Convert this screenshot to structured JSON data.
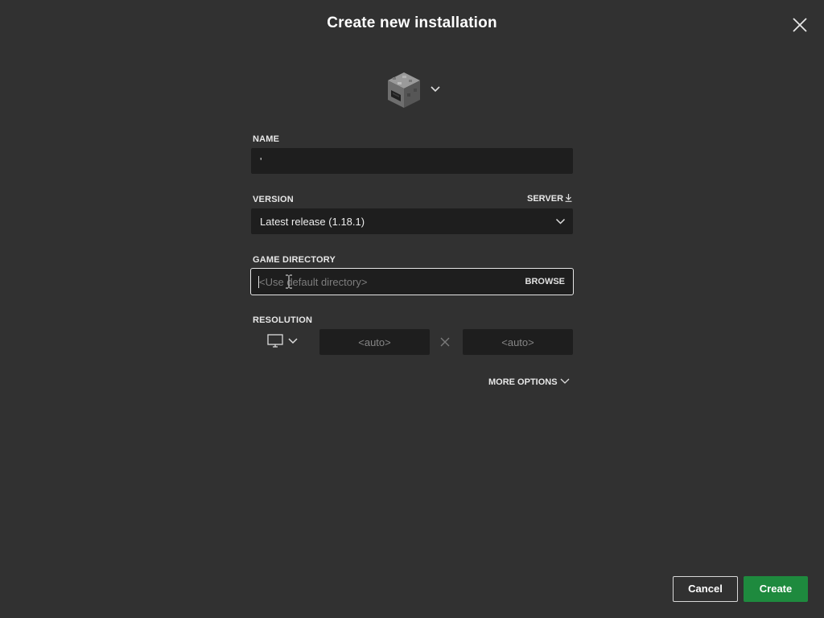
{
  "dialog": {
    "title": "Create new installation",
    "close_icon": "close-icon"
  },
  "icon_picker": {
    "icon": "furnace-block-icon",
    "dropdown_icon": "chevron-down-icon"
  },
  "name": {
    "label": "NAME",
    "value": "'"
  },
  "version": {
    "label": "VERSION",
    "server_label": "SERVER",
    "server_icon": "download-icon",
    "selected": "Latest release (1.18.1)"
  },
  "game_directory": {
    "label": "GAME DIRECTORY",
    "placeholder": "<Use default directory>",
    "browse_label": "BROWSE",
    "focused": true
  },
  "resolution": {
    "label": "RESOLUTION",
    "monitor_icon": "monitor-icon",
    "width_placeholder": "<auto>",
    "height_placeholder": "<auto>",
    "separator_icon": "times-icon"
  },
  "more_options": {
    "label": "MORE OPTIONS"
  },
  "footer": {
    "cancel_label": "Cancel",
    "create_label": "Create"
  },
  "colors": {
    "background": "#313131",
    "field": "#1e1e1e",
    "accent_green": "#1e8a3e",
    "focus_border": "#e6e6e6"
  }
}
